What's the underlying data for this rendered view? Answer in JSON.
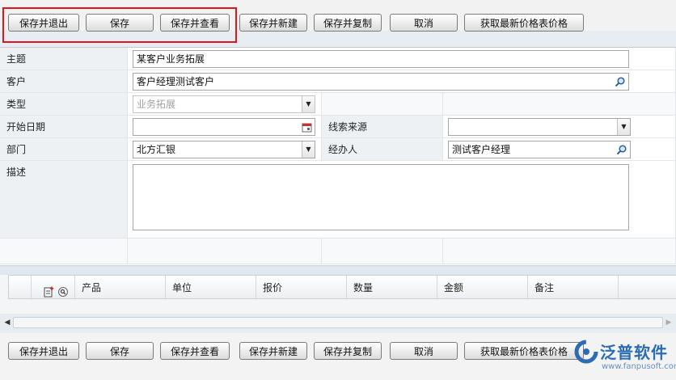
{
  "toolbar_buttons": [
    "保存并退出",
    "保存",
    "保存并查看",
    "保存并新建",
    "保存并复制",
    "取消",
    "获取最新价格表价格"
  ],
  "form": {
    "subject": {
      "label": "主题",
      "value": "某客户业务拓展"
    },
    "customer": {
      "label": "客户",
      "value": "客户经理测试客户"
    },
    "type": {
      "label": "类型",
      "value": "业务拓展"
    },
    "start_date": {
      "label": "开始日期",
      "value": ""
    },
    "lead_source": {
      "label": "线索来源",
      "value": ""
    },
    "department": {
      "label": "部门",
      "value": "北方汇银"
    },
    "handler": {
      "label": "经办人",
      "value": "测试客户经理"
    },
    "description": {
      "label": "描述",
      "value": ""
    }
  },
  "grid": {
    "columns": [
      "产品",
      "单位",
      "报价",
      "数量",
      "金额",
      "备注"
    ]
  },
  "watermark": {
    "text": "泛普软件",
    "url": "www.fanpusoft.com"
  },
  "colors": {
    "highlight": "#e0161b",
    "label_bg": "#eef1f4",
    "brand": "#2b6cb5"
  }
}
